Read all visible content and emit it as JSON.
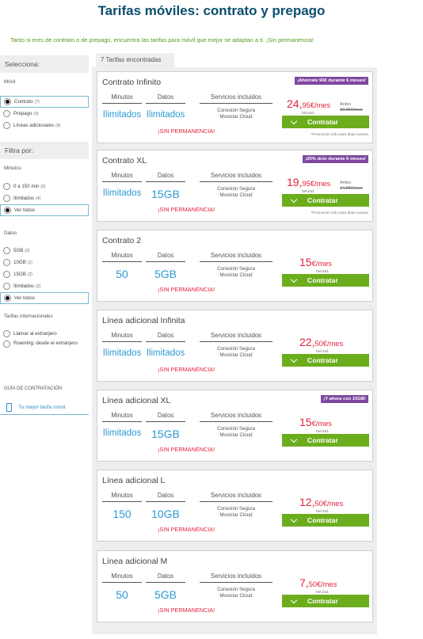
{
  "header": {
    "title": "Tarifas móviles: contrato y prepago",
    "subtitle": "Tanto si eres de contrato o de prepago, encuentra las tarifas para móvil que mejor se adaptan a ti. ¡Sin permanencia!"
  },
  "sidebar": {
    "selecciona_label": "Selecciona:",
    "movil_label": "Móvil",
    "movil_options": [
      {
        "label": "Contrato",
        "count": "(7)",
        "selected": true
      },
      {
        "label": "Prepago",
        "count": "(3)",
        "selected": false
      },
      {
        "label": "Líneas adicionales",
        "count": "(4)",
        "selected": false
      }
    ],
    "filtra_label": "Filtra por:",
    "minutos_label": "Minutos",
    "minutos_options": [
      {
        "label": "0 a 150 min",
        "count": "(3)",
        "selected": false
      },
      {
        "label": "Ilimitados",
        "count": "(4)",
        "selected": false
      },
      {
        "label": "Ver todos",
        "count": "",
        "selected": true
      }
    ],
    "datos_label": "Datos",
    "datos_options": [
      {
        "label": "5GB",
        "count": "(2)",
        "selected": false
      },
      {
        "label": "10GB",
        "count": "(1)",
        "selected": false
      },
      {
        "label": "15GB",
        "count": "(2)",
        "selected": false
      },
      {
        "label": "Ilimitados",
        "count": "(2)",
        "selected": false
      },
      {
        "label": "Ver todos",
        "count": "",
        "selected": true
      }
    ],
    "internacionales_label": "Tarifas internacionales",
    "int_options": [
      {
        "label": "Llamar al extranjero"
      },
      {
        "label": "Roaming: desde el extranjero"
      }
    ],
    "guia_label": "GUÍA DE CONTRATACIÓN",
    "tu_tarifa_label": "Tu mejor tarifa móvil",
    "tu_tarifa_icon": "phone-icon"
  },
  "results": {
    "found_label": "7 Tarifas encontradas",
    "col_minutos": "Minutos",
    "col_datos": "Datos",
    "col_servicios": "Servicios incluidos",
    "servicios_line1": "Conexión Segura",
    "servicios_line2": "Movistar Cloud",
    "sin_permanencia": "¡SIN PERMANENCIA!",
    "button_label": "Contratar",
    "iva_label": "IVA incl.",
    "antes_label": "Antes",
    "promo_note": "*Promoción sólo para altas nuevas",
    "colors": {
      "accent_green": "#6cad1d",
      "price_red": "#e2233c",
      "badge_purple": "#7e479f",
      "value_blue": "#2e9ad4",
      "title_navy": "#0b4e6e"
    },
    "tariffs": [
      {
        "name": "Contrato Infinito",
        "minutes": "Ilimitados",
        "data": "Ilimitados",
        "price_int": "24,",
        "price_dec": "95€/mes",
        "badge": "¡Ahórrate 90€ durante 6 meses!",
        "antes_price": "39,95€/mes"
      },
      {
        "name": "Contrato XL",
        "minutes": "Ilimitados",
        "data": "15GB",
        "price_int": "19,",
        "price_dec": "95€/mes",
        "badge": "¡20% dcto durante 6 meses!",
        "antes_price": "24,95€/mes"
      },
      {
        "name": "Contrato 2",
        "minutes": "50",
        "data": "5GB",
        "price_int": "15",
        "price_dec": "€/mes"
      },
      {
        "name": "Línea adicional Infinita",
        "minutes": "Ilimitados",
        "data": "Ilimitados",
        "price_int": "22,",
        "price_dec": "50€/mes"
      },
      {
        "name": "Línea adicional XL",
        "minutes": "Ilimitados",
        "data": "15GB",
        "price_int": "15",
        "price_dec": "€/mes",
        "badge": "¡Y ahora con 15GB!"
      },
      {
        "name": "Línea adicional L",
        "minutes": "150",
        "data": "10GB",
        "price_int": "12,",
        "price_dec": "50€/mes"
      },
      {
        "name": "Línea adicional M",
        "minutes": "50",
        "data": "5GB",
        "price_int": "7,",
        "price_dec": "50€/mes"
      }
    ]
  }
}
